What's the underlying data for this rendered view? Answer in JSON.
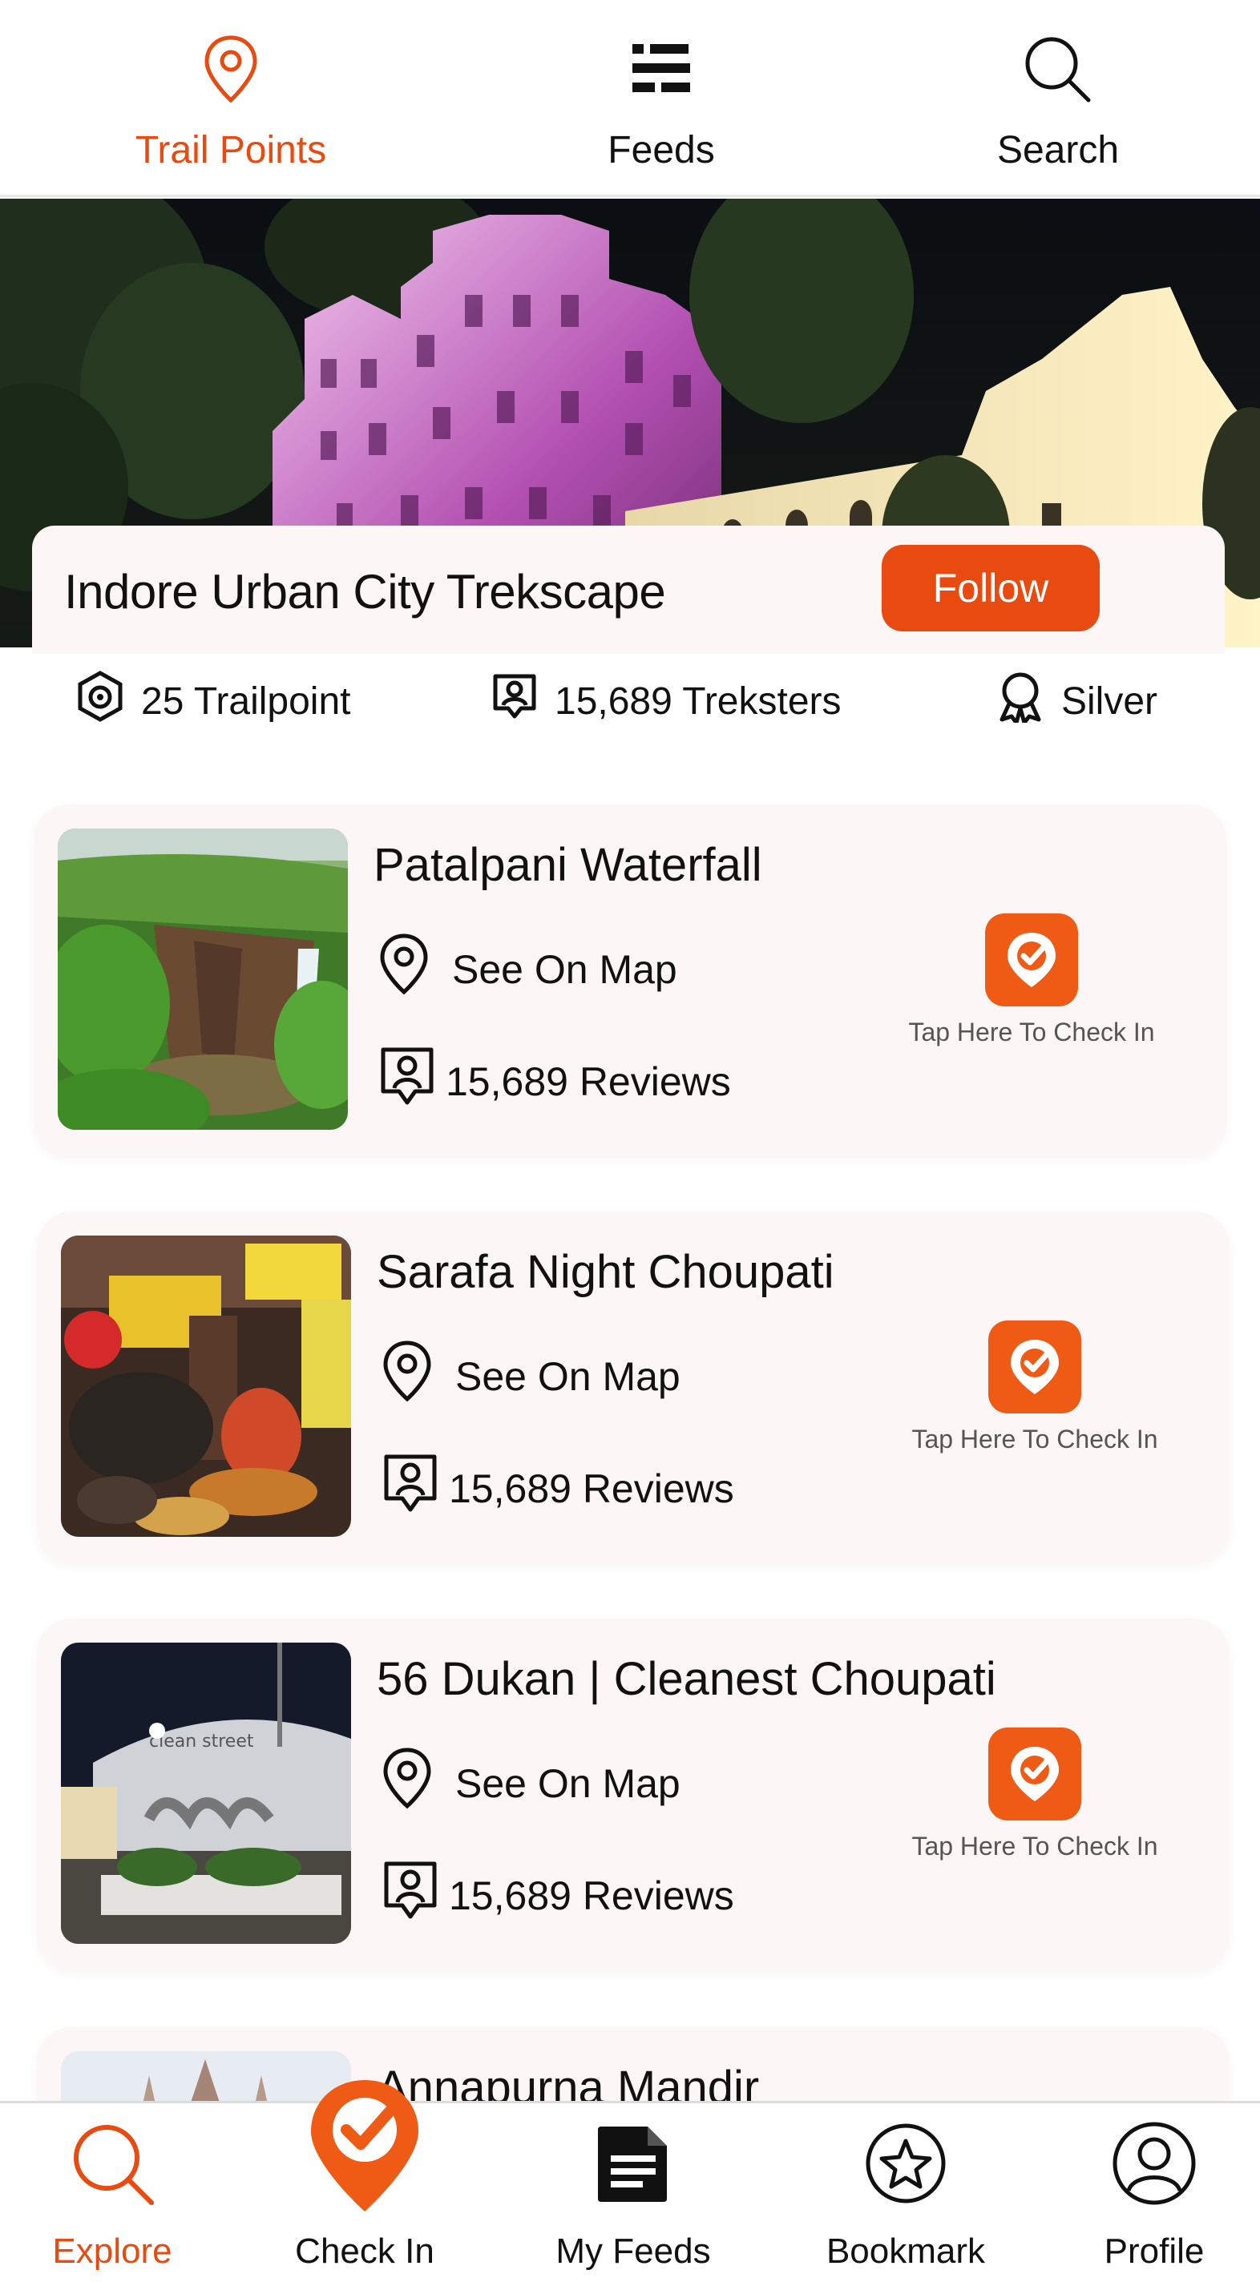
{
  "top_tabs": {
    "trail_points": "Trail Points",
    "feeds": "Feeds",
    "search": "Search",
    "active": "trail_points"
  },
  "header": {
    "title": "Indore Urban City Trekscape",
    "follow_label": "Follow"
  },
  "stats": {
    "trailpoints": "25 Trailpoint",
    "treksters": "15,689 Treksters",
    "level": "Silver"
  },
  "trail_points": [
    {
      "name": "Patalpani Waterfall",
      "map_label": "See On Map",
      "reviews": "15,689 Reviews",
      "checkin_label": "Tap Here To Check In",
      "image": "waterfall-photo"
    },
    {
      "name": "Sarafa Night Choupati",
      "map_label": "See On Map",
      "reviews": "15,689 Reviews",
      "checkin_label": "Tap Here To Check In",
      "image": "night-market-photo"
    },
    {
      "name": "56 Dukan | Cleanest Choupati",
      "map_label": "See On Map",
      "reviews": "15,689 Reviews",
      "checkin_label": "Tap Here To Check In",
      "image": "food-hub-photo"
    },
    {
      "name": "Annapurna Mandir",
      "image": "temple-photo"
    }
  ],
  "bottom_nav": {
    "explore": "Explore",
    "check_in": "Check In",
    "my_feeds": "My Feeds",
    "bookmark": "Bookmark",
    "profile": "Profile",
    "active": "explore"
  },
  "colors": {
    "accent": "#e84a10",
    "card_bg": "#fcf7f6",
    "checkin_bg": "#ef5a14"
  }
}
